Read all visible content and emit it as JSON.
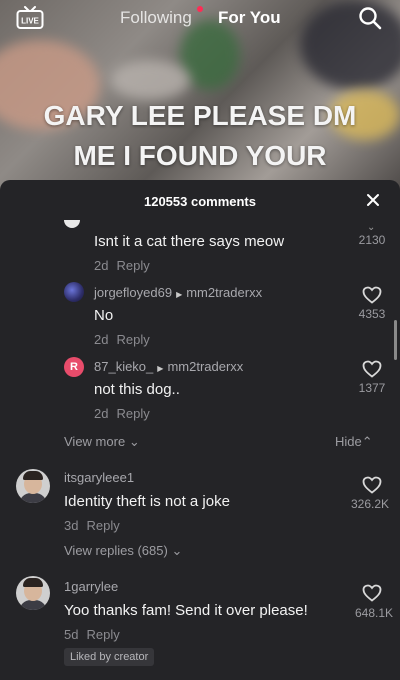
{
  "header": {
    "live_label": "LIVE",
    "tab_following": "Following",
    "tab_for_you": "For You"
  },
  "video": {
    "caption_line1": "GARY LEE PLEASE DM",
    "caption_line2": "ME I FOUND YOUR"
  },
  "comments_panel": {
    "count_label": "120553 comments",
    "replies": [
      {
        "text": "Isnt it a cat there says meow",
        "age": "2d",
        "reply_label": "Reply",
        "likes": "2130"
      },
      {
        "user": "jorgefloyed69",
        "to": "mm2traderxx",
        "avatar_letter": "",
        "text": "No",
        "age": "2d",
        "reply_label": "Reply",
        "likes": "4353"
      },
      {
        "user": "87_kieko_",
        "to": "mm2traderxx",
        "avatar_letter": "R",
        "text": "not this dog..",
        "age": "2d",
        "reply_label": "Reply",
        "likes": "1377"
      }
    ],
    "view_more": "View more",
    "hide": "Hide",
    "comments": [
      {
        "user": "itsgaryleee1",
        "text": "Identity theft is not a joke",
        "age": "3d",
        "reply_label": "Reply",
        "likes": "326.2K",
        "view_replies": "View replies (685)"
      },
      {
        "user": "1garrylee",
        "text": "Yoo thanks fam! Send it over please!",
        "age": "5d",
        "reply_label": "Reply",
        "likes": "648.1K",
        "badge": "Liked by creator"
      }
    ]
  },
  "colors": {
    "sheet_bg": "#242427",
    "accent": "#fe2c55"
  }
}
